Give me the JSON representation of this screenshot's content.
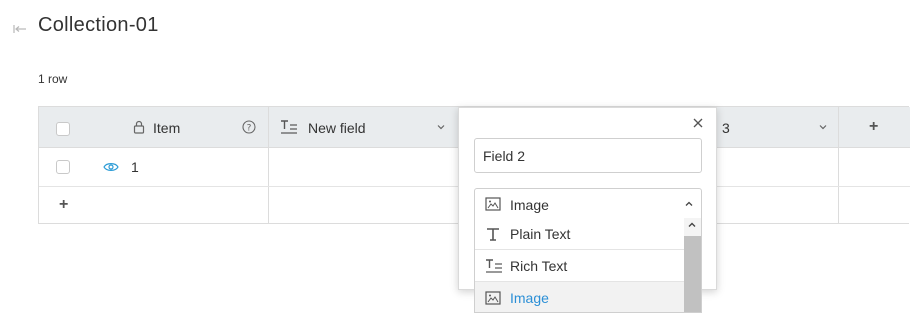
{
  "page": {
    "title": "Collection-01",
    "row_count": "1 row"
  },
  "table": {
    "columns": [
      {
        "label": "Item",
        "icon": "lock-icon",
        "help_icon": "help-circle-icon"
      },
      {
        "label": "New field",
        "icon": "rich-text-icon",
        "menu_icon": "chevron-down-icon"
      },
      {
        "label": "3",
        "menu_icon": "chevron-down-icon"
      }
    ],
    "add_column_label": "+",
    "rows": [
      {
        "item": "1",
        "visible_icon": "eye-icon"
      }
    ],
    "add_row_label": "+"
  },
  "field_popup": {
    "name_value": "Field 2",
    "type_selected": "Image",
    "type_options": [
      {
        "label": "Plain Text",
        "icon": "plain-text-icon"
      },
      {
        "label": "Rich Text",
        "icon": "rich-text-icon"
      },
      {
        "label": "Image",
        "icon": "image-icon",
        "selected": true
      }
    ]
  },
  "colors": {
    "header_bg": "#e9ecee",
    "accent": "#2b8fd6",
    "border": "#dcdcdc"
  }
}
